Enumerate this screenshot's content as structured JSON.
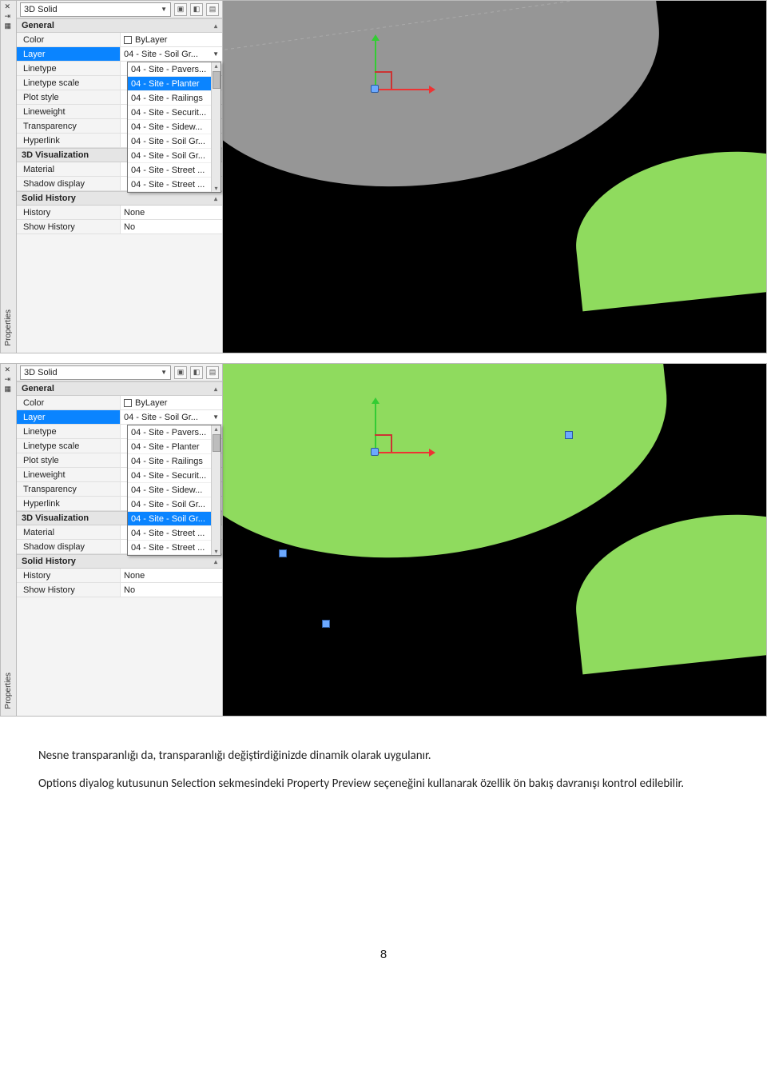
{
  "sideRail": {
    "title": "Properties"
  },
  "toolbar": {
    "selectValue": "3D Solid"
  },
  "sections": {
    "general": "General",
    "viz": "3D Visualization",
    "solid": "Solid History"
  },
  "props": {
    "color": {
      "label": "Color",
      "value": "ByLayer"
    },
    "layer": {
      "label": "Layer",
      "value": "04 - Site - Soil Gr..."
    },
    "linetype": {
      "label": "Linetype"
    },
    "ltscale": {
      "label": "Linetype scale"
    },
    "plotstyle": {
      "label": "Plot style"
    },
    "lineweight": {
      "label": "Lineweight"
    },
    "transparency": {
      "label": "Transparency"
    },
    "hyperlink": {
      "label": "Hyperlink"
    },
    "material": {
      "label": "Material"
    },
    "shadow": {
      "label": "Shadow display"
    },
    "history": {
      "label": "History",
      "value": "None"
    },
    "showhistory": {
      "label": "Show History",
      "value": "No"
    }
  },
  "dropdownA": {
    "items": [
      "04 - Site - Pavers...",
      "04 - Site - Planter",
      "04 - Site - Railings",
      "04 - Site - Securit...",
      "04 - Site - Sidew...",
      "04 - Site - Soil Gr...",
      "04 - Site - Soil Gr...",
      "04 - Site - Street ...",
      "04 - Site - Street ..."
    ],
    "highlightIndex": 1
  },
  "dropdownB": {
    "items": [
      "04 - Site - Pavers...",
      "04 - Site - Planter",
      "04 - Site - Railings",
      "04 - Site - Securit...",
      "04 - Site - Sidew...",
      "04 - Site - Soil Gr...",
      "04 - Site - Soil Gr...",
      "04 - Site - Street ...",
      "04 - Site - Street ..."
    ],
    "highlightIndex": 6
  },
  "body": {
    "p1": "Nesne transparanlığı da, transparanlığı değiştirdiğinizde dinamik olarak uygulanır.",
    "p2": "Options diyalog kutusunun Selection sekmesindeki Property Preview seçeneğini kullanarak özellik ön bakış davranışı kontrol edilebilir."
  },
  "pageNumber": "8"
}
